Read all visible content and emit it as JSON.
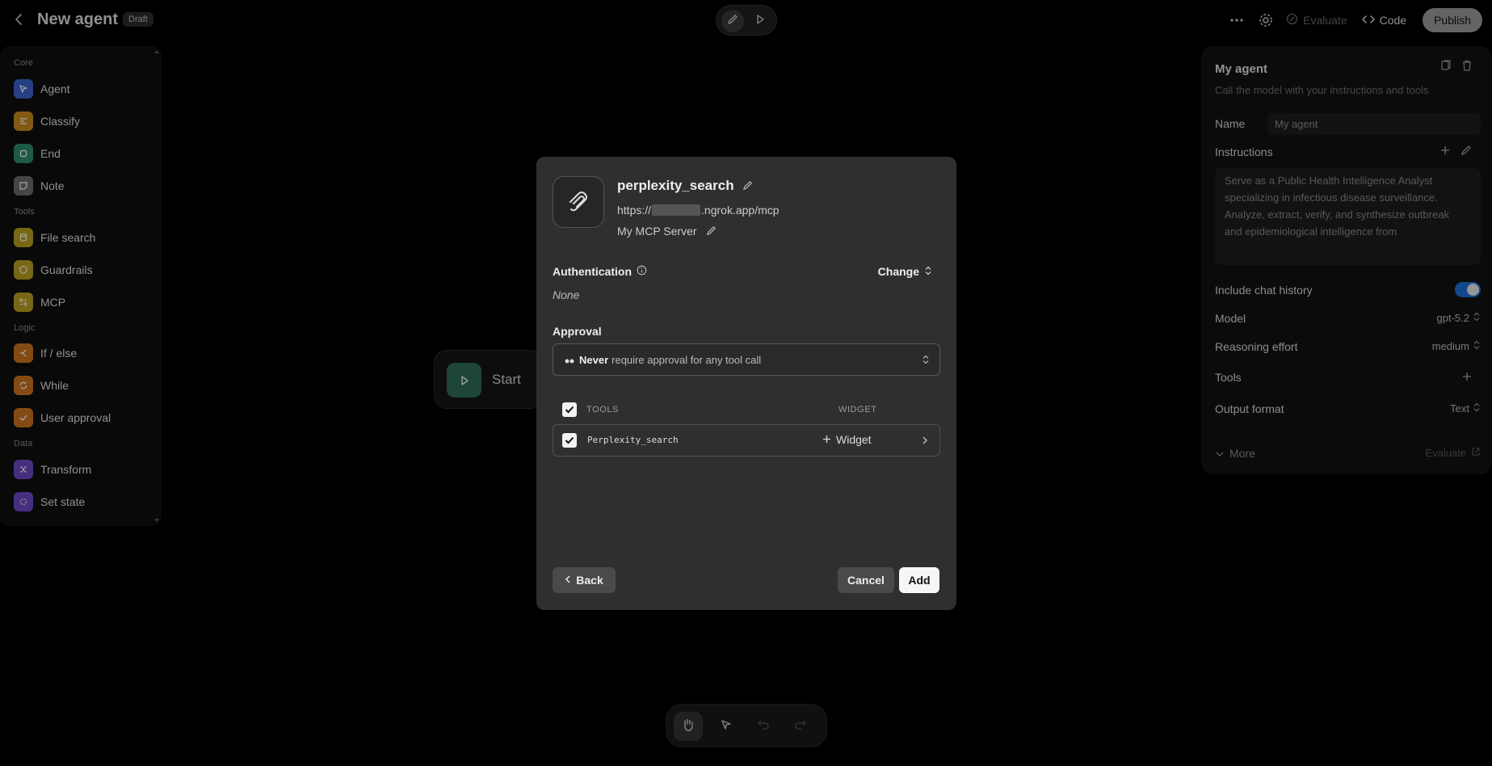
{
  "header": {
    "title": "New agent",
    "badge": "Draft",
    "evaluate_label": "Evaluate",
    "code_label": "Code",
    "publish_label": "Publish"
  },
  "sidebar": {
    "sections": [
      {
        "title": "Core",
        "items": [
          {
            "label": "Agent",
            "icon": "cursor-arrow-icon",
            "color": "#3b63c9"
          },
          {
            "label": "Classify",
            "icon": "classify-icon",
            "color": "#c98a1e"
          },
          {
            "label": "End",
            "icon": "square-stop-icon",
            "color": "#2f8a6a"
          },
          {
            "label": "Note",
            "icon": "note-icon",
            "color": "#6a6a6a"
          }
        ]
      },
      {
        "title": "Tools",
        "items": [
          {
            "label": "File search",
            "icon": "database-icon",
            "color": "#b8a020"
          },
          {
            "label": "Guardrails",
            "icon": "shield-icon",
            "color": "#b8a020"
          },
          {
            "label": "MCP",
            "icon": "mcp-icon",
            "color": "#b8a020"
          }
        ]
      },
      {
        "title": "Logic",
        "items": [
          {
            "label": "If / else",
            "icon": "branch-icon",
            "color": "#c9731e"
          },
          {
            "label": "While",
            "icon": "loop-icon",
            "color": "#c9731e"
          },
          {
            "label": "User approval",
            "icon": "approval-icon",
            "color": "#c9731e"
          }
        ]
      },
      {
        "title": "Data",
        "items": [
          {
            "label": "Transform",
            "icon": "shuffle-icon",
            "color": "#6b4bc4"
          },
          {
            "label": "Set state",
            "icon": "state-icon",
            "color": "#6b4bc4"
          }
        ]
      }
    ]
  },
  "canvas": {
    "start_label": "Start"
  },
  "panel": {
    "title": "My agent",
    "subtitle": "Call the model with your instructions and tools",
    "name_label": "Name",
    "name_value": "My agent",
    "instructions_label": "Instructions",
    "instructions_text": "Serve as a Public Health Intelligence Analyst specializing in infectious disease surveillance. Analyze, extract, verify, and synthesize outbreak and epidemiological intelligence from",
    "chat_history_label": "Include chat history",
    "chat_history_enabled": true,
    "model_label": "Model",
    "model_value": "gpt-5.2",
    "reasoning_label": "Reasoning effort",
    "reasoning_value": "medium",
    "tools_label": "Tools",
    "output_label": "Output format",
    "output_value": "Text",
    "more_label": "More",
    "evaluate_label": "Evaluate"
  },
  "modal": {
    "server_name": "perplexity_search",
    "url_prefix": "https://",
    "url_suffix": ".ngrok.app/mcp",
    "server_label": "My MCP Server",
    "auth_label": "Authentication",
    "change_label": "Change",
    "auth_value": "None",
    "approval_label": "Approval",
    "approval_strong": "Never",
    "approval_rest": "require approval for any tool call",
    "tools_header": "TOOLS",
    "widget_header": "WIDGET",
    "tools": [
      {
        "name": "Perplexity_search",
        "widget_label": "Widget",
        "checked": true
      }
    ],
    "back_label": "Back",
    "cancel_label": "Cancel",
    "add_label": "Add"
  }
}
